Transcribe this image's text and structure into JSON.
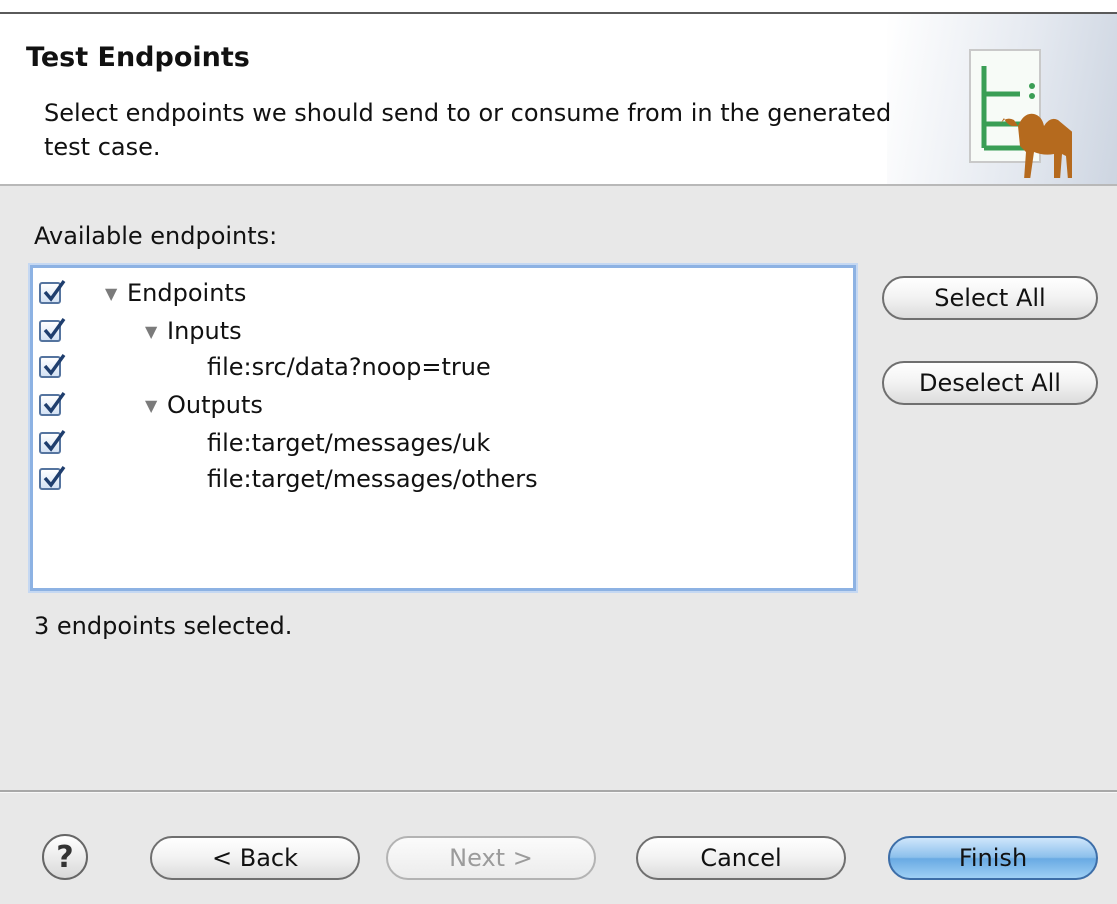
{
  "header": {
    "title": "Test Endpoints",
    "description": "Select endpoints we should send to or consume from in the generated test case."
  },
  "tree_section": {
    "label": "Available endpoints:",
    "items": [
      {
        "label": "Endpoints",
        "checked": true,
        "expandable": true,
        "level": 0
      },
      {
        "label": "Inputs",
        "checked": true,
        "expandable": true,
        "level": 1
      },
      {
        "label": "file:src/data?noop=true",
        "checked": true,
        "expandable": false,
        "level": 2
      },
      {
        "label": "Outputs",
        "checked": true,
        "expandable": true,
        "level": 1
      },
      {
        "label": "file:target/messages/uk",
        "checked": true,
        "expandable": false,
        "level": 2
      },
      {
        "label": "file:target/messages/others",
        "checked": true,
        "expandable": false,
        "level": 2
      }
    ]
  },
  "buttons": {
    "select_all": "Select All",
    "deselect_all": "Deselect All"
  },
  "status": "3 endpoints selected.",
  "footer": {
    "help": "?",
    "back": "< Back",
    "next": "Next >",
    "cancel": "Cancel",
    "finish": "Finish"
  },
  "icons": {
    "banner": "camel-test-wizard-icon",
    "checkbox": "checkmark-icon",
    "expand": "triangle-down-icon",
    "help": "question-mark-icon"
  },
  "colors": {
    "default_button": "#69aae3",
    "tree_focus": "#8db2e3",
    "camel": "#b56a1e",
    "banner_lines": "#3a9e55"
  }
}
